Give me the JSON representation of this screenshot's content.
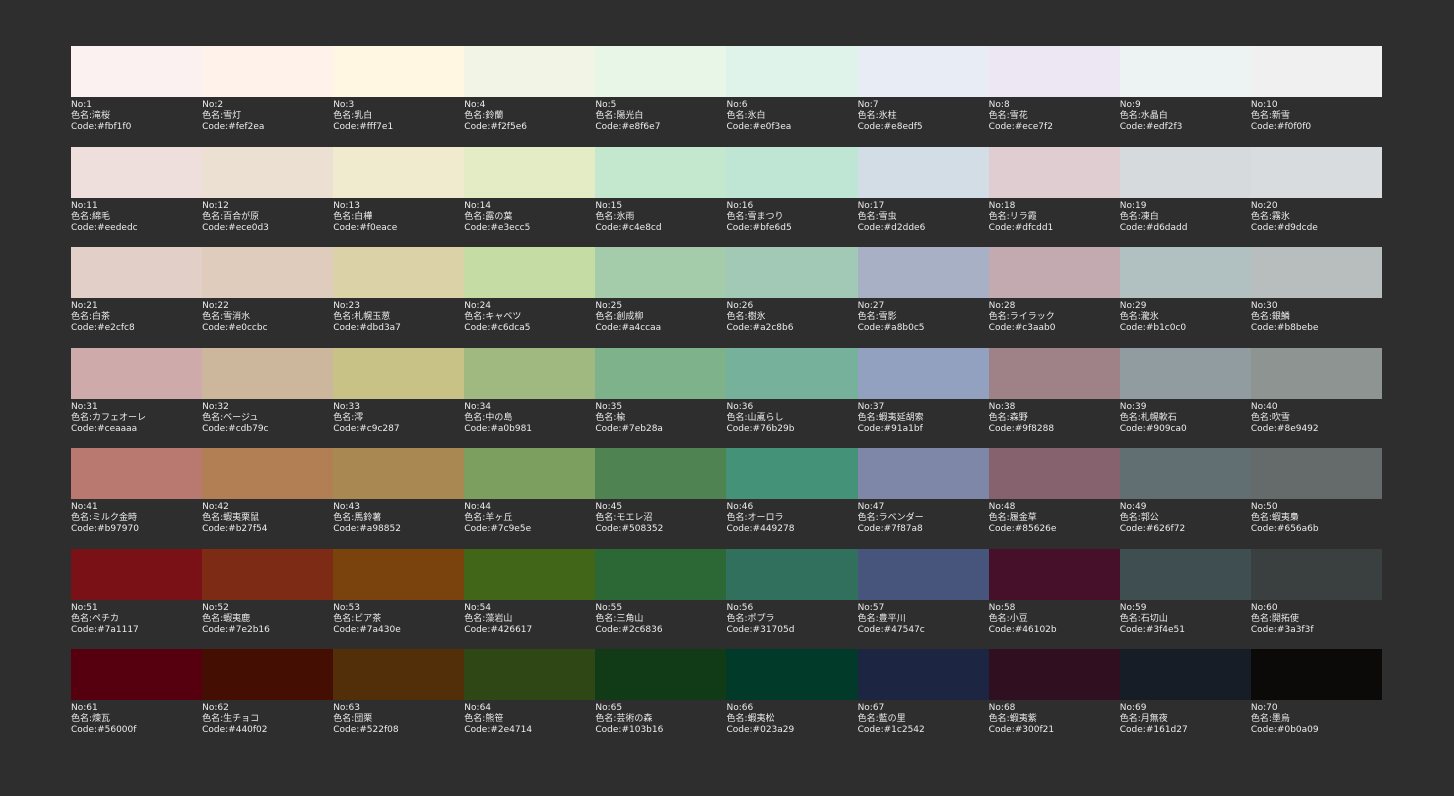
{
  "labels": {
    "no": "No:",
    "name": "色名:",
    "code": "Code:"
  },
  "colors": [
    {
      "no": "1",
      "name": "滝桜",
      "code": "#fbf1f0"
    },
    {
      "no": "2",
      "name": "雪灯",
      "code": "#fef2ea"
    },
    {
      "no": "3",
      "name": "乳白",
      "code": "#fff7e1"
    },
    {
      "no": "4",
      "name": "鈴蘭",
      "code": "#f2f5e6"
    },
    {
      "no": "5",
      "name": "陽光白",
      "code": "#e8f6e7"
    },
    {
      "no": "6",
      "name": "氷白",
      "code": "#e0f3ea"
    },
    {
      "no": "7",
      "name": "氷柱",
      "code": "#e8edf5"
    },
    {
      "no": "8",
      "name": "雪花",
      "code": "#ece7f2"
    },
    {
      "no": "9",
      "name": "水晶白",
      "code": "#edf2f3"
    },
    {
      "no": "10",
      "name": "新雪",
      "code": "#f0f0f0"
    },
    {
      "no": "11",
      "name": "綿毛",
      "code": "#eededc"
    },
    {
      "no": "12",
      "name": "百合が原",
      "code": "#ece0d3"
    },
    {
      "no": "13",
      "name": "白樺",
      "code": "#f0eace"
    },
    {
      "no": "14",
      "name": "露の葉",
      "code": "#e3ecc5"
    },
    {
      "no": "15",
      "name": "氷雨",
      "code": "#c4e8cd"
    },
    {
      "no": "16",
      "name": "雪まつり",
      "code": "#bfe6d5"
    },
    {
      "no": "17",
      "name": "雪虫",
      "code": "#d2dde6"
    },
    {
      "no": "18",
      "name": "リラ霞",
      "code": "#dfcdd1"
    },
    {
      "no": "19",
      "name": "凍白",
      "code": "#d6dadd"
    },
    {
      "no": "20",
      "name": "霧氷",
      "code": "#d9dcde"
    },
    {
      "no": "21",
      "name": "白茶",
      "code": "#e2cfc8"
    },
    {
      "no": "22",
      "name": "雪消水",
      "code": "#e0ccbc"
    },
    {
      "no": "23",
      "name": "札幌玉葱",
      "code": "#dbd3a7"
    },
    {
      "no": "24",
      "name": "キャベツ",
      "code": "#c6dca5"
    },
    {
      "no": "25",
      "name": "創成柳",
      "code": "#a4ccaa"
    },
    {
      "no": "26",
      "name": "樹氷",
      "code": "#a2c8b6"
    },
    {
      "no": "27",
      "name": "雪影",
      "code": "#a8b0c5"
    },
    {
      "no": "28",
      "name": "ライラック",
      "code": "#c3aab0"
    },
    {
      "no": "29",
      "name": "瀧氷",
      "code": "#b1c0c0"
    },
    {
      "no": "30",
      "name": "銀鱗",
      "code": "#b8bebe"
    },
    {
      "no": "31",
      "name": "カフェオーレ",
      "code": "#ceaaaa"
    },
    {
      "no": "32",
      "name": "ベージュ",
      "code": "#cdb79c"
    },
    {
      "no": "33",
      "name": "澪",
      "code": "#c9c287"
    },
    {
      "no": "34",
      "name": "中の島",
      "code": "#a0b981"
    },
    {
      "no": "35",
      "name": "楡",
      "code": "#7eb28a"
    },
    {
      "no": "36",
      "name": "山颪らし",
      "code": "#76b29b"
    },
    {
      "no": "37",
      "name": "蝦夷延胡索",
      "code": "#91a1bf"
    },
    {
      "no": "38",
      "name": "森野",
      "code": "#9f8288"
    },
    {
      "no": "39",
      "name": "札幌軟石",
      "code": "#909ca0"
    },
    {
      "no": "40",
      "name": "吹雪",
      "code": "#8e9492"
    },
    {
      "no": "41",
      "name": "ミルク金時",
      "code": "#b97970"
    },
    {
      "no": "42",
      "name": "蝦夷栗鼠",
      "code": "#b27f54"
    },
    {
      "no": "43",
      "name": "馬鈴薯",
      "code": "#a98852"
    },
    {
      "no": "44",
      "name": "羊ヶ丘",
      "code": "#7c9e5e"
    },
    {
      "no": "45",
      "name": "モエレ沼",
      "code": "#508352"
    },
    {
      "no": "46",
      "name": "オーロラ",
      "code": "#449278"
    },
    {
      "no": "47",
      "name": "ラベンダー",
      "code": "#7f87a8"
    },
    {
      "no": "48",
      "name": "履金草",
      "code": "#85626e"
    },
    {
      "no": "49",
      "name": "郭公",
      "code": "#626f72"
    },
    {
      "no": "50",
      "name": "蝦夷梟",
      "code": "#656a6b"
    },
    {
      "no": "51",
      "name": "ペチカ",
      "code": "#7a1117"
    },
    {
      "no": "52",
      "name": "蝦夷鹿",
      "code": "#7e2b16"
    },
    {
      "no": "53",
      "name": "ビア茶",
      "code": "#7a430e"
    },
    {
      "no": "54",
      "name": "藻岩山",
      "code": "#426617"
    },
    {
      "no": "55",
      "name": "三角山",
      "code": "#2c6836"
    },
    {
      "no": "56",
      "name": "ポプラ",
      "code": "#31705d"
    },
    {
      "no": "57",
      "name": "豊平川",
      "code": "#47547c"
    },
    {
      "no": "58",
      "name": "小豆",
      "code": "#46102b"
    },
    {
      "no": "59",
      "name": "石切山",
      "code": "#3f4e51"
    },
    {
      "no": "60",
      "name": "開拓使",
      "code": "#3a3f3f"
    },
    {
      "no": "61",
      "name": "煉瓦",
      "code": "#56000f"
    },
    {
      "no": "62",
      "name": "生チョコ",
      "code": "#440f02"
    },
    {
      "no": "63",
      "name": "団栗",
      "code": "#522f08"
    },
    {
      "no": "64",
      "name": "熊笹",
      "code": "#2e4714"
    },
    {
      "no": "65",
      "name": "芸術の森",
      "code": "#103b16"
    },
    {
      "no": "66",
      "name": "蝦夷松",
      "code": "#023a29"
    },
    {
      "no": "67",
      "name": "藍の里",
      "code": "#1c2542"
    },
    {
      "no": "68",
      "name": "蝦夷紫",
      "code": "#300f21"
    },
    {
      "no": "69",
      "name": "月無夜",
      "code": "#161d27"
    },
    {
      "no": "70",
      "name": "墨烏",
      "code": "#0b0a09"
    }
  ]
}
